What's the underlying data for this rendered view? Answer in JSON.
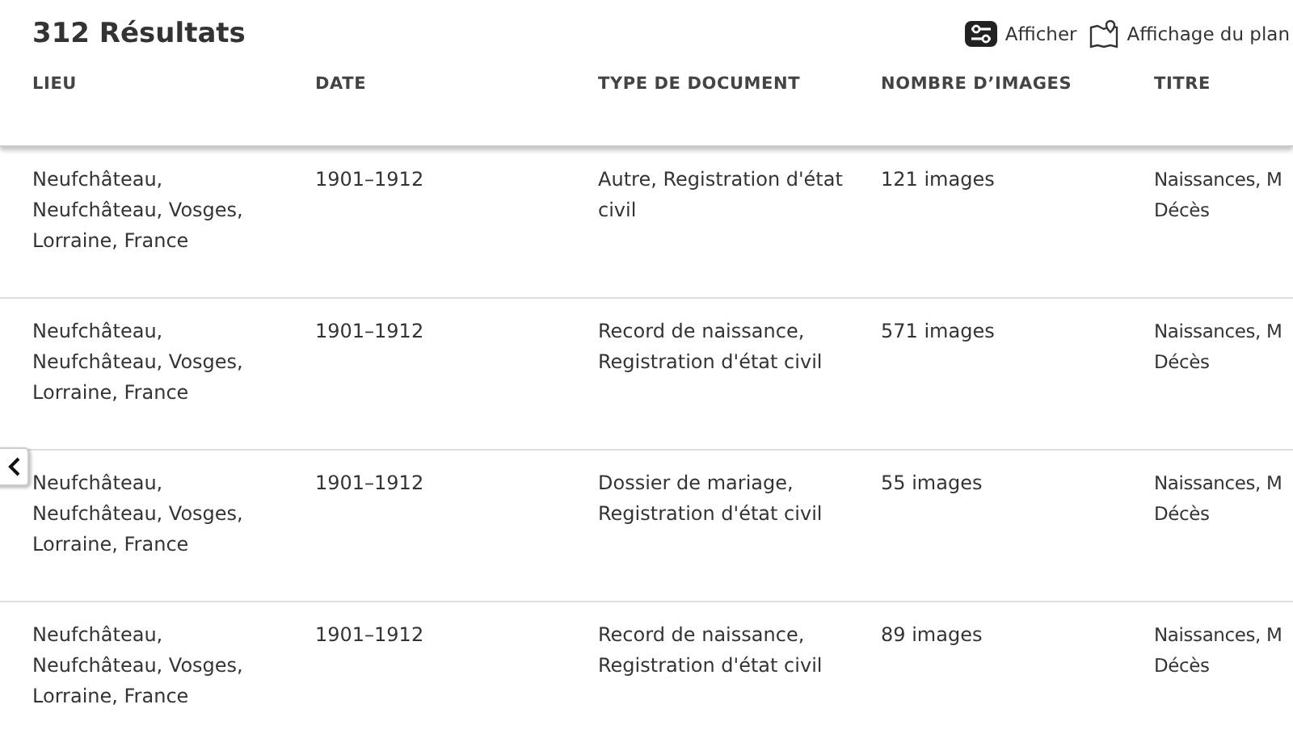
{
  "results_title": "312 Résultats",
  "toolbar": [
    {
      "kind": "filter",
      "label": "Afficher"
    },
    {
      "kind": "map",
      "label": "Affichage du plan"
    }
  ],
  "table": {
    "columns": [
      "LIEU",
      "DATE",
      "TYPE DE DOCUMENT",
      "NOMBRE D’IMAGES",
      "TITRE"
    ],
    "rows": [
      [
        "Neufchâteau, Neufchâteau, Vosges, Lorraine, France",
        "1901–1912",
        "Autre, Registration d'état civil",
        "121 images",
        "Naissances, M Décès"
      ],
      [
        "Neufchâteau, Neufchâteau, Vosges, Lorraine, France",
        "1901–1912",
        "Record de naissance, Registration d'état civil",
        "571 images",
        "Naissances, M Décès"
      ],
      [
        "Neufchâteau, Neufchâteau, Vosges, Lorraine, France",
        "1901–1912",
        "Dossier de mariage, Registration d'état civil",
        "55 images",
        "Naissances, M Décès"
      ],
      [
        "Neufchâteau, Neufchâteau, Vosges, Lorraine, France",
        "1901–1912",
        "Record de naissance, Registration d'état civil",
        "89 images",
        "Naissances, M Décès"
      ]
    ]
  }
}
